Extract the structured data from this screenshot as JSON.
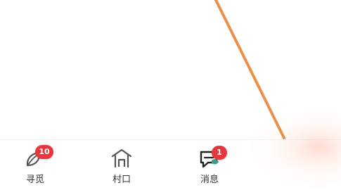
{
  "bottom_nav": {
    "items": [
      {
        "label": "寻觅",
        "icon": "leaf-icon",
        "badge": "10"
      },
      {
        "label": "村口",
        "icon": "house-icon",
        "badge": ""
      },
      {
        "label": "消息",
        "icon": "chat-bubble-icon",
        "badge": "1"
      }
    ]
  },
  "colors": {
    "badge": "#e5373c",
    "annotation_line": "#e8914a",
    "icon_stroke": "#555555",
    "label": "#333333"
  }
}
